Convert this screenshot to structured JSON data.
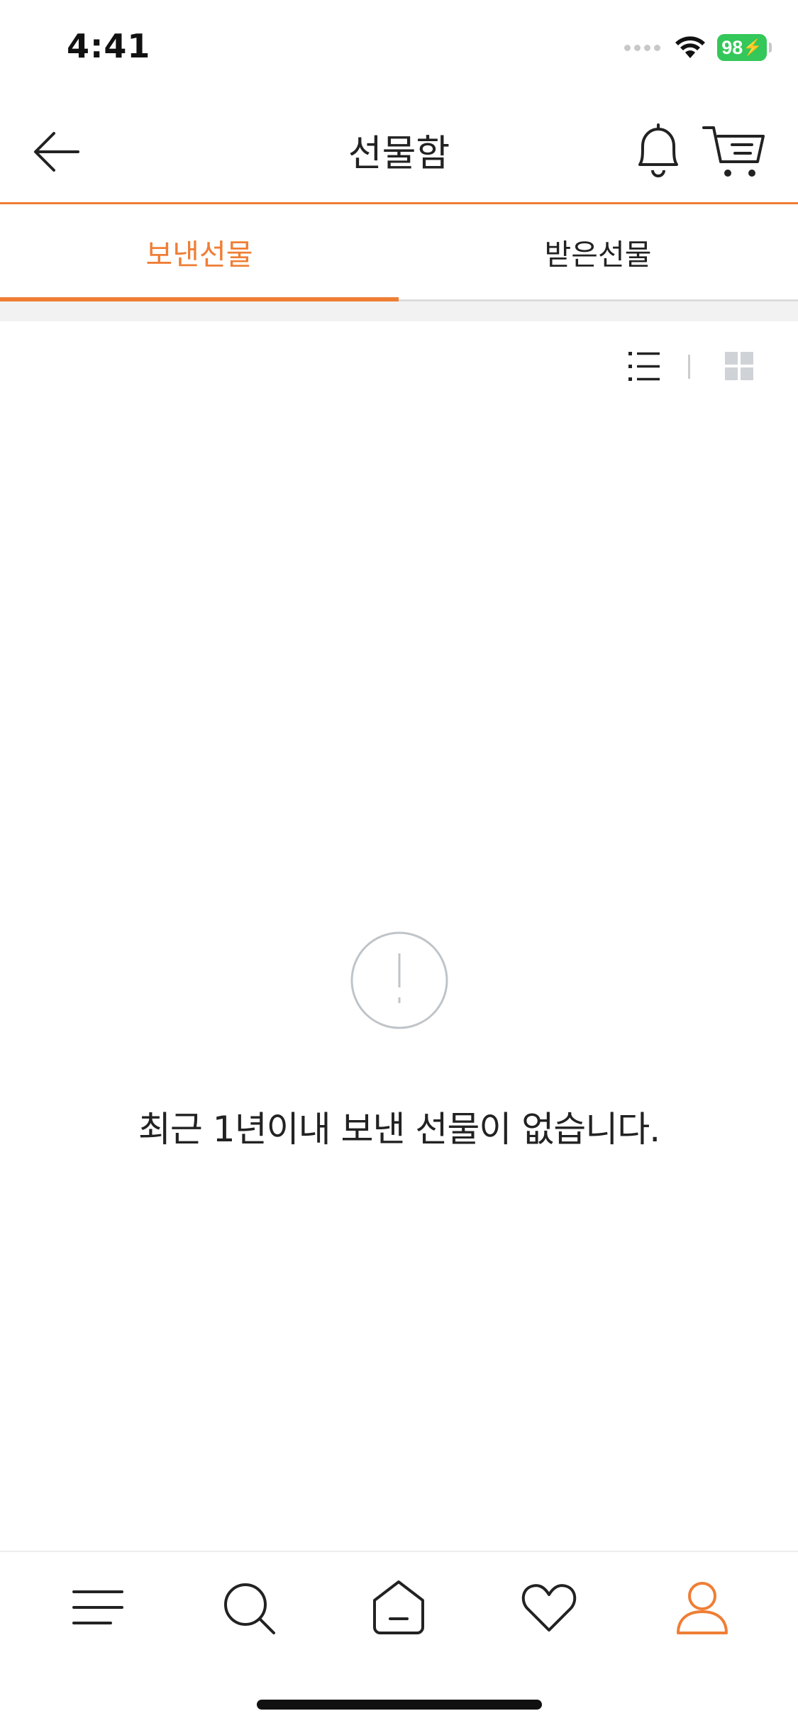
{
  "status_bar": {
    "time": "4:41",
    "battery": "98"
  },
  "header": {
    "title": "선물함",
    "icons": {
      "back": "arrow-left-icon",
      "notifications": "bell-icon",
      "cart": "cart-icon"
    }
  },
  "tabs": [
    {
      "label": "보낸선물",
      "active": true
    },
    {
      "label": "받은선물",
      "active": false
    }
  ],
  "view_toggle": {
    "selected": "list",
    "icons": [
      "list-icon",
      "grid-icon"
    ]
  },
  "empty_state": {
    "icon": "alert-circle-icon",
    "message": "최근 1년이내 보낸 선물이 없습니다."
  },
  "bottom_nav": {
    "items": [
      "menu",
      "search",
      "home",
      "wishlist",
      "my-page"
    ],
    "active": "my-page"
  },
  "colors": {
    "accent": "#ef7e35",
    "text": "#222222",
    "divider": "#dcdcdc",
    "battery": "#34c759"
  }
}
